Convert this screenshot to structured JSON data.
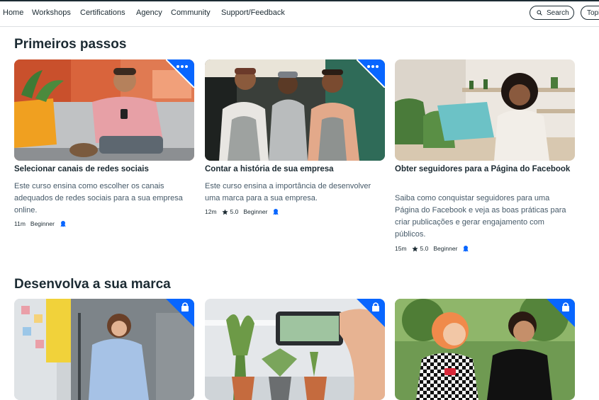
{
  "nav": {
    "items": [
      "Home",
      "Workshops",
      "Certifications",
      "Agency",
      "Community",
      "Support/Feedback"
    ],
    "search_label": "Search",
    "topics_label": "Topi"
  },
  "sections": [
    {
      "title": "Primeiros passos",
      "cards": [
        {
          "title": "Selecionar canais de redes sociais",
          "description": "Este curso ensina como escolher os canais adequados de redes sociais para a sua empresa online.",
          "duration": "11m",
          "rating": "",
          "level": "Beginner",
          "badge": "more-icon"
        },
        {
          "title": "Contar a história de sua empresa",
          "description": "Este curso ensina a importância de desenvolver uma marca para a sua empresa.",
          "duration": "12m",
          "rating": "5.0",
          "level": "Beginner",
          "badge": "more-icon"
        },
        {
          "title": "Obter seguidores para a Página do Facebook",
          "description": "Saiba como conquistar seguidores para uma Página do Facebook e veja as boas práticas para criar publicações e gerar engajamento com públicos.",
          "duration": "15m",
          "rating": "5.0",
          "level": "Beginner",
          "badge": "none"
        }
      ]
    },
    {
      "title": "Desenvolva a sua marca",
      "cards": [
        {
          "badge": "lock-icon"
        },
        {
          "badge": "lock-icon"
        },
        {
          "badge": "lock-icon"
        }
      ]
    }
  ],
  "colors": {
    "brand_blue": "#0866ff",
    "text": "#1c2b33",
    "muted": "#465a69"
  }
}
